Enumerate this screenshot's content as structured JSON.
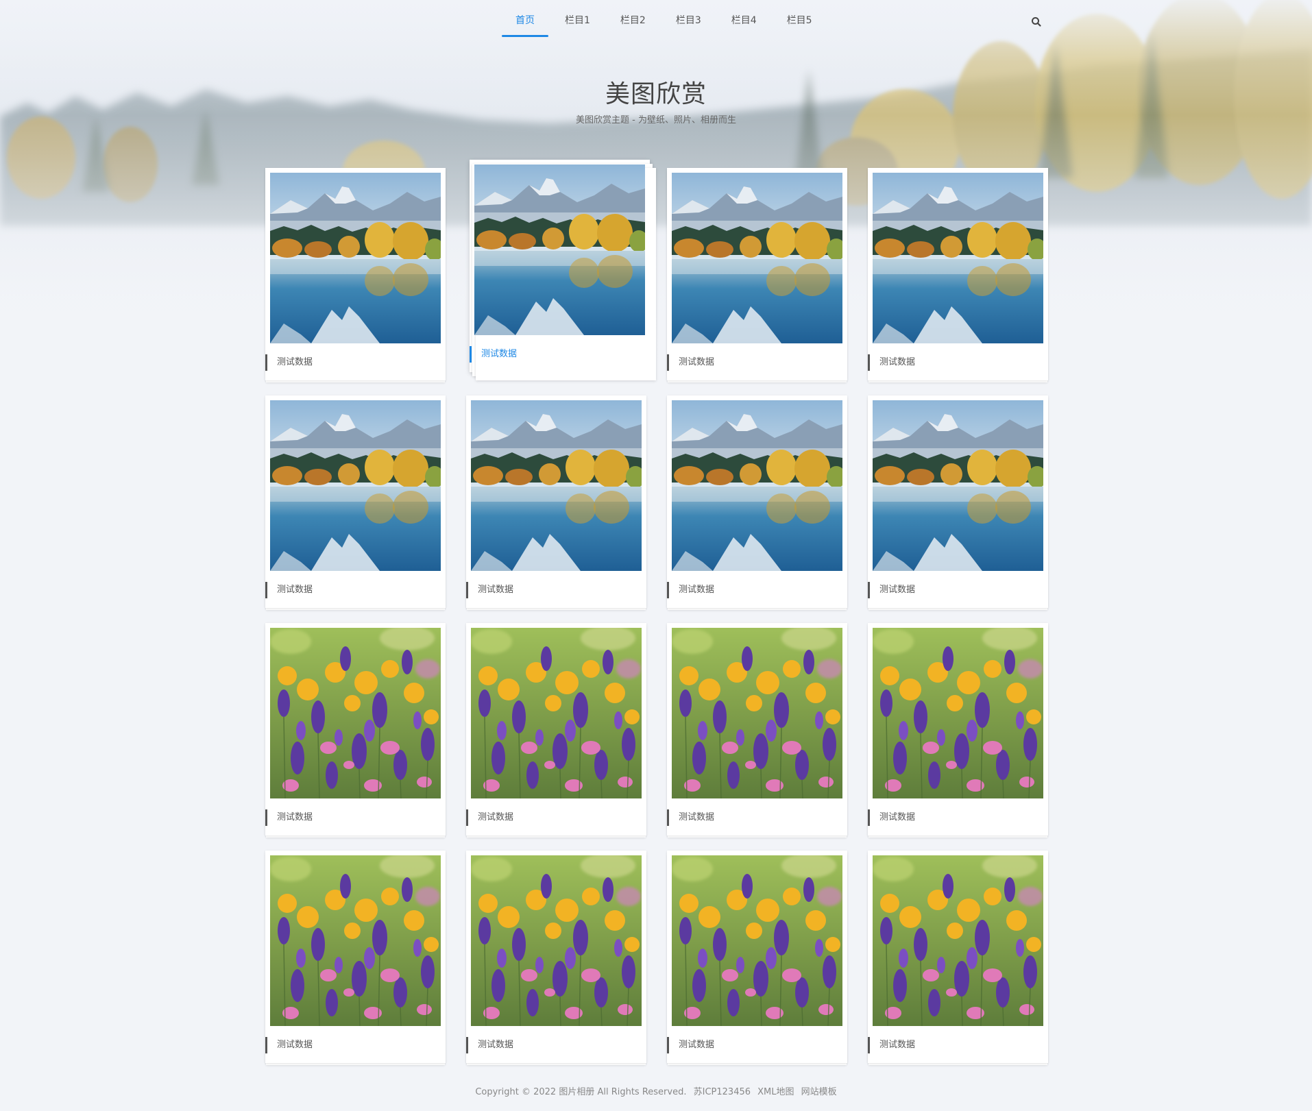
{
  "nav": {
    "items": [
      {
        "label": "首页",
        "active": true
      },
      {
        "label": "栏目1",
        "active": false
      },
      {
        "label": "栏目2",
        "active": false
      },
      {
        "label": "栏目3",
        "active": false
      },
      {
        "label": "栏目4",
        "active": false
      },
      {
        "label": "栏目5",
        "active": false
      }
    ],
    "search_icon": "search-icon"
  },
  "header": {
    "title": "美图欣赏",
    "subtitle": "美图欣赏主题 - 为壁纸、照片、相册而生"
  },
  "gallery": {
    "items": [
      {
        "label": "测试数据",
        "image": "mountain-lake-photo"
      },
      {
        "label": "测试数据",
        "image": "mountain-lake-photo",
        "hovered": true
      },
      {
        "label": "测试数据",
        "image": "mountain-lake-photo"
      },
      {
        "label": "测试数据",
        "image": "mountain-lake-photo"
      },
      {
        "label": "测试数据",
        "image": "mountain-lake-photo"
      },
      {
        "label": "测试数据",
        "image": "mountain-lake-photo"
      },
      {
        "label": "测试数据",
        "image": "mountain-lake-photo"
      },
      {
        "label": "测试数据",
        "image": "mountain-lake-photo"
      },
      {
        "label": "测试数据",
        "image": "flower-field-photo"
      },
      {
        "label": "测试数据",
        "image": "flower-field-photo"
      },
      {
        "label": "测试数据",
        "image": "flower-field-photo"
      },
      {
        "label": "测试数据",
        "image": "flower-field-photo"
      },
      {
        "label": "测试数据",
        "image": "flower-field-photo"
      },
      {
        "label": "测试数据",
        "image": "flower-field-photo"
      },
      {
        "label": "测试数据",
        "image": "flower-field-photo"
      },
      {
        "label": "测试数据",
        "image": "flower-field-photo"
      }
    ]
  },
  "footer": {
    "copyright": "Copyright © 2022 图片相册 All Rights Reserved.",
    "icp": "苏ICP123456",
    "sitemap": "XML地图",
    "template": "网站模板"
  },
  "colors": {
    "accent": "#1e88e5",
    "text": "#555555",
    "background": "#f2f4f8"
  }
}
